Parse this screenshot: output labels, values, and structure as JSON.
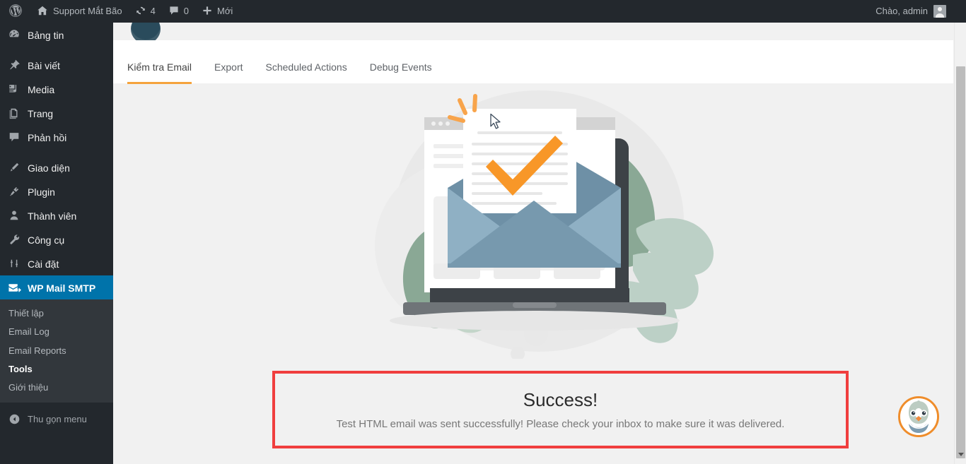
{
  "adminbar": {
    "wp_logo_label": "",
    "site_name": "Support Mắt Bão",
    "updates_count": "4",
    "comments_count": "0",
    "new_label": "Mới",
    "greeting": "Chào, admin"
  },
  "sidebar": {
    "items": [
      {
        "label": "Bảng tin",
        "icon": "dashboard-icon",
        "name": "dashboard"
      },
      {
        "label": "Bài viết",
        "icon": "pin-icon",
        "name": "posts"
      },
      {
        "label": "Media",
        "icon": "media-icon",
        "name": "media"
      },
      {
        "label": "Trang",
        "icon": "pages-icon",
        "name": "pages"
      },
      {
        "label": "Phản hồi",
        "icon": "comment-icon",
        "name": "comments"
      },
      {
        "label": "Giao diện",
        "icon": "appearance-icon",
        "name": "appearance"
      },
      {
        "label": "Plugin",
        "icon": "plugin-icon",
        "name": "plugins"
      },
      {
        "label": "Thành viên",
        "icon": "users-icon",
        "name": "users"
      },
      {
        "label": "Công cụ",
        "icon": "tools-icon",
        "name": "tools"
      },
      {
        "label": "Cài đặt",
        "icon": "settings-icon",
        "name": "settings"
      },
      {
        "label": "WP Mail SMTP",
        "icon": "mail-send-icon",
        "name": "wp-mail-smtp",
        "current": true
      }
    ],
    "submenu": [
      {
        "label": "Thiết lập",
        "name": "settings"
      },
      {
        "label": "Email Log",
        "name": "email-log"
      },
      {
        "label": "Email Reports",
        "name": "email-reports"
      },
      {
        "label": "Tools",
        "name": "tools",
        "current": true
      },
      {
        "label": "Giới thiệu",
        "name": "about"
      }
    ],
    "collapse_label": "Thu gọn menu"
  },
  "tabs": [
    {
      "label": "Kiểm tra Email",
      "name": "email-test",
      "active": true
    },
    {
      "label": "Export",
      "name": "export"
    },
    {
      "label": "Scheduled Actions",
      "name": "scheduled-actions"
    },
    {
      "label": "Debug Events",
      "name": "debug-events"
    }
  ],
  "notice": {
    "title": "Success!",
    "message": "Test HTML email was sent successfully! Please check your inbox to make sure it was delivered.",
    "border_color": "#f03e3e",
    "background": "#f1f1f1"
  },
  "illustration": {
    "name": "email-sent-success-illustration",
    "colors": {
      "envelope_back": "#8fb0c4",
      "envelope_front": "#7799ae",
      "envelope_flap": "#6e90a6",
      "check_orange": "#f89728",
      "laptop_dark": "#3d4247",
      "laptop_base": "#6f7478",
      "leaf_dark": "#8aa895",
      "leaf_light": "#bcd0c6",
      "blob_gray": "#e4e4e4"
    }
  },
  "chat": {
    "name": "support-chat-bubble",
    "ring_color": "#ef8d2b"
  },
  "theme": {
    "admin_bar_bg": "#23282d",
    "menu_bg": "#23282d",
    "submenu_bg": "#32373c",
    "current_menu_bg": "#0073aa",
    "content_bg": "#f1f1f1",
    "tab_accent": "#f5a33c"
  }
}
